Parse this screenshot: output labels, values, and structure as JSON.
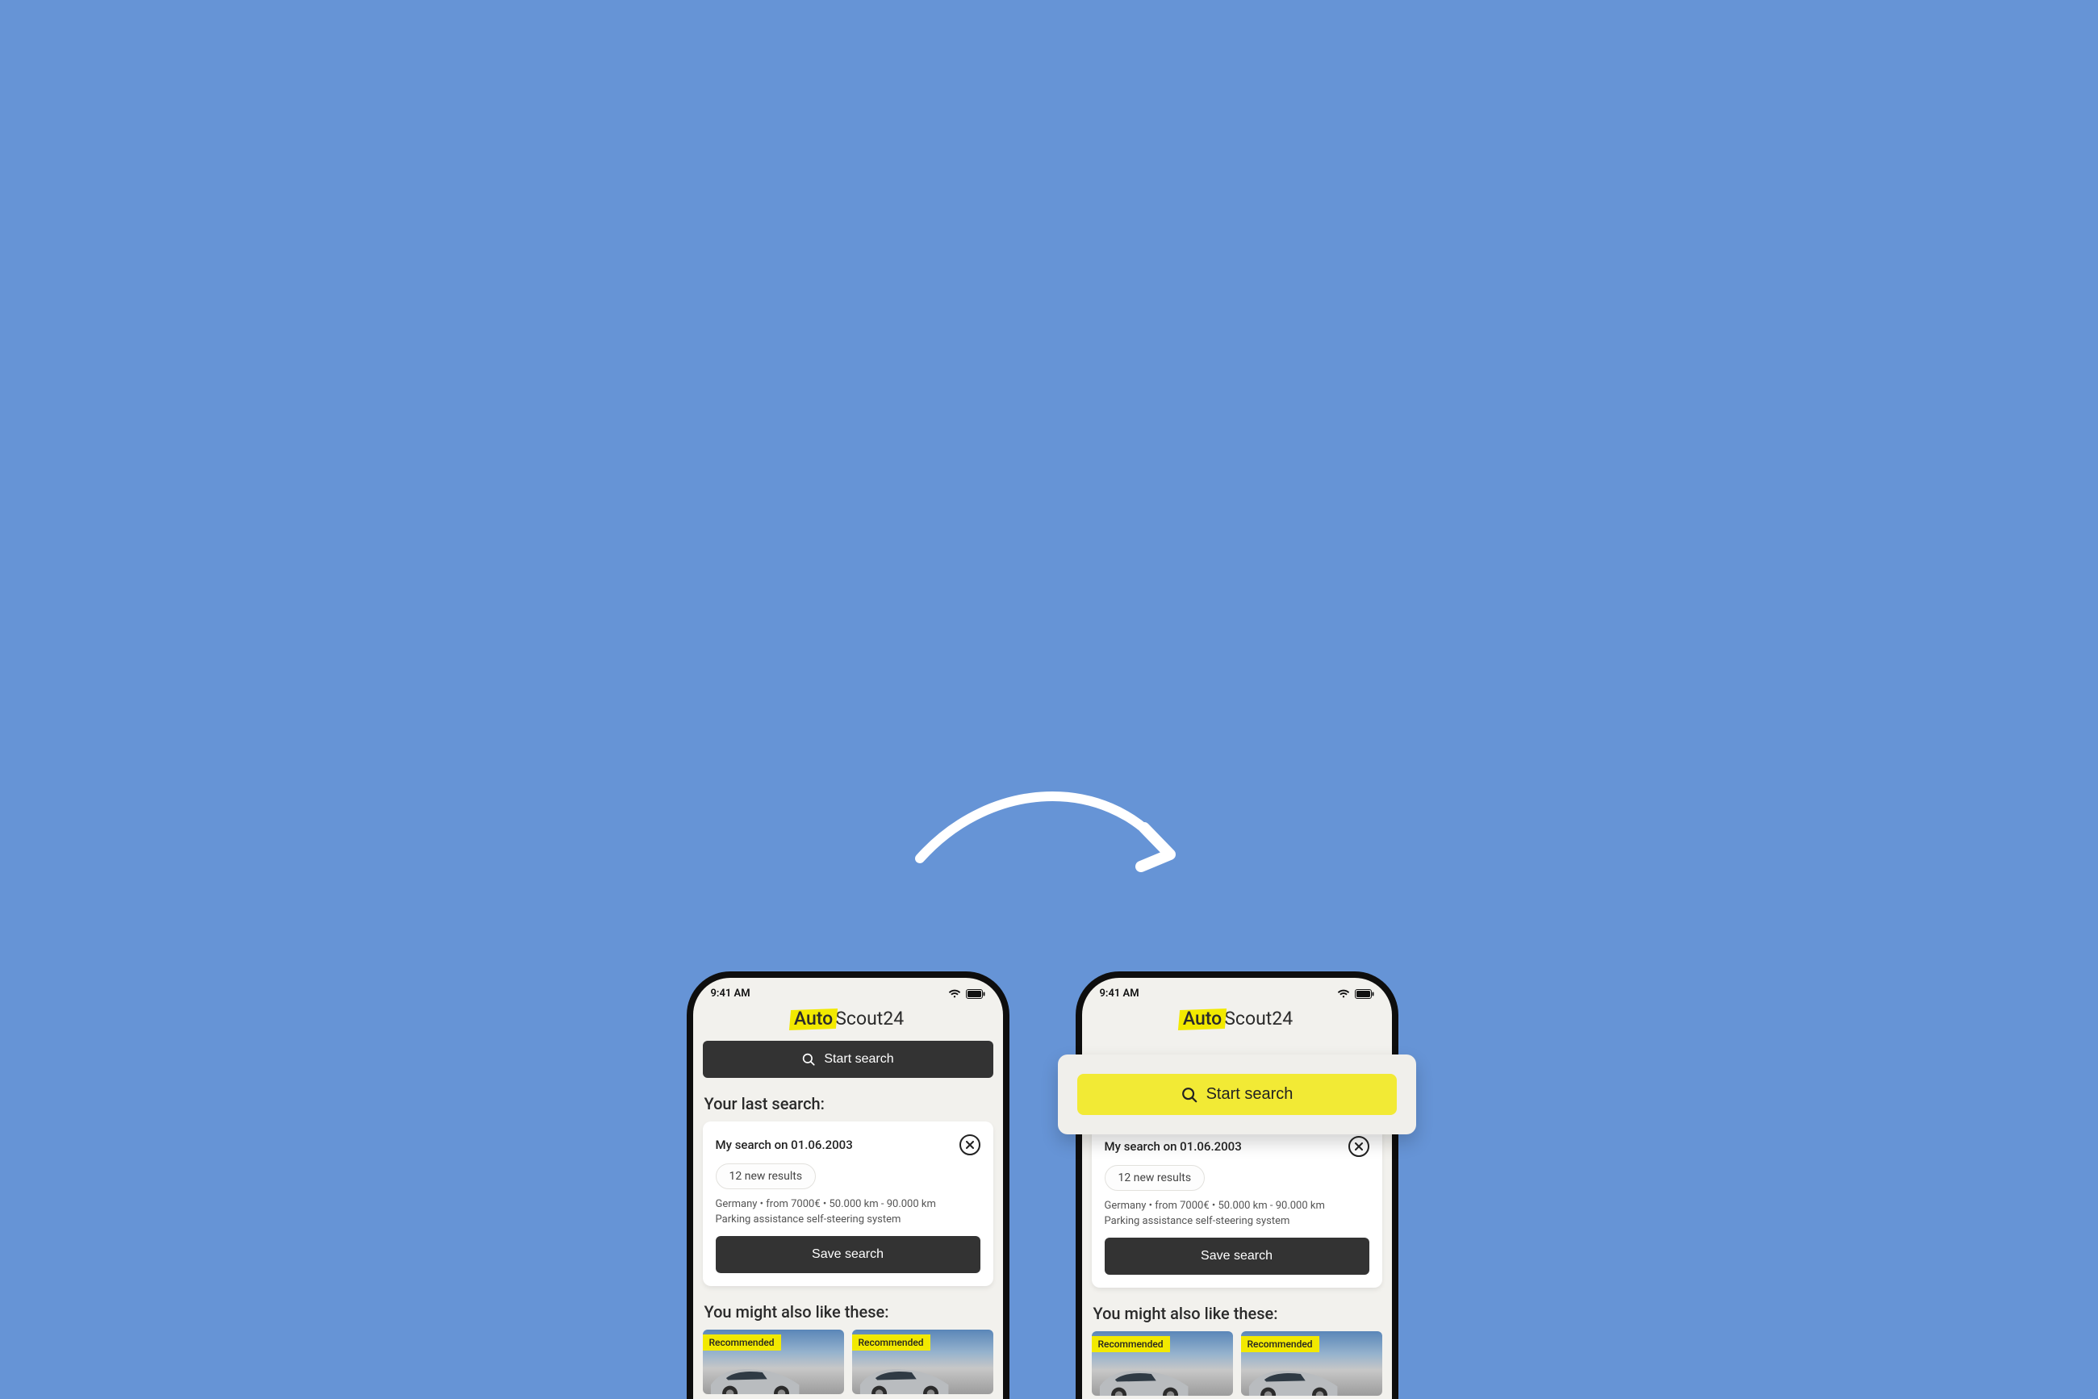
{
  "status_time": "9:41 AM",
  "logo": {
    "highlight": "Auto",
    "rest": "Scout24"
  },
  "start_search_label": "Start search",
  "sections": {
    "last_search": "Your last search:",
    "suggestions": "You might also like these:"
  },
  "last_search_card": {
    "title": "My search on 01.06.2003",
    "chip": "12 new results",
    "meta_line1": "Germany  •  from 7000€  •  50.000 km - 90.000 km",
    "meta_line2": "Parking assistance self-steering system",
    "save_label": "Save search"
  },
  "rec_badge": "Recommended"
}
